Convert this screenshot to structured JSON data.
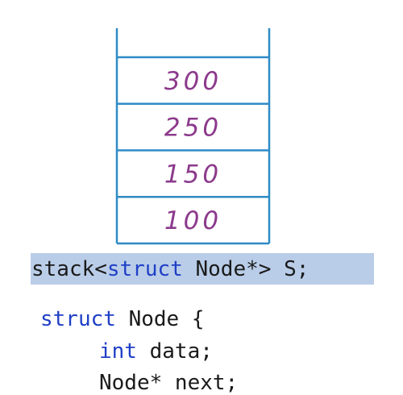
{
  "stack": {
    "cells": [
      "300",
      "250",
      "150",
      "100"
    ],
    "border_color": "#2e8bc6",
    "value_color": "#8c3a8c"
  },
  "code": {
    "highlight_color": "#b9cde8",
    "keyword_color": "#1f3fc6",
    "line1": {
      "prefix": "stack<",
      "keyword": "struct",
      "suffix": " Node*> S;"
    },
    "line2": {
      "keyword": "struct",
      "suffix": " Node {"
    },
    "line3": {
      "keyword": "int",
      "suffix": " data;"
    },
    "line4": {
      "text": "Node* next;"
    }
  }
}
